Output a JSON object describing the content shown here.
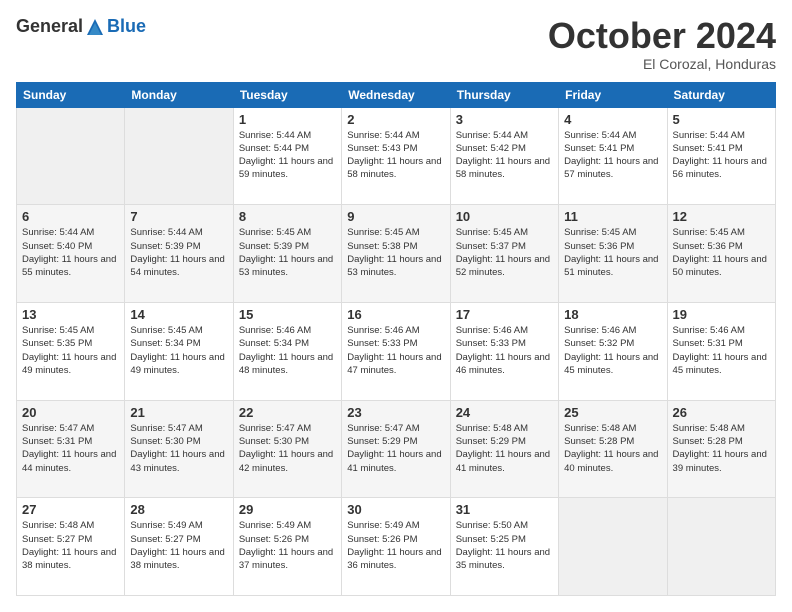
{
  "logo": {
    "general": "General",
    "blue": "Blue"
  },
  "header": {
    "month": "October 2024",
    "location": "El Corozal, Honduras"
  },
  "weekdays": [
    "Sunday",
    "Monday",
    "Tuesday",
    "Wednesday",
    "Thursday",
    "Friday",
    "Saturday"
  ],
  "weeks": [
    [
      null,
      null,
      {
        "day": 1,
        "sunrise": "5:44 AM",
        "sunset": "5:44 PM",
        "daylight": "11 hours and 59 minutes."
      },
      {
        "day": 2,
        "sunrise": "5:44 AM",
        "sunset": "5:43 PM",
        "daylight": "11 hours and 58 minutes."
      },
      {
        "day": 3,
        "sunrise": "5:44 AM",
        "sunset": "5:42 PM",
        "daylight": "11 hours and 58 minutes."
      },
      {
        "day": 4,
        "sunrise": "5:44 AM",
        "sunset": "5:41 PM",
        "daylight": "11 hours and 57 minutes."
      },
      {
        "day": 5,
        "sunrise": "5:44 AM",
        "sunset": "5:41 PM",
        "daylight": "11 hours and 56 minutes."
      }
    ],
    [
      {
        "day": 6,
        "sunrise": "5:44 AM",
        "sunset": "5:40 PM",
        "daylight": "11 hours and 55 minutes."
      },
      {
        "day": 7,
        "sunrise": "5:44 AM",
        "sunset": "5:39 PM",
        "daylight": "11 hours and 54 minutes."
      },
      {
        "day": 8,
        "sunrise": "5:45 AM",
        "sunset": "5:39 PM",
        "daylight": "11 hours and 53 minutes."
      },
      {
        "day": 9,
        "sunrise": "5:45 AM",
        "sunset": "5:38 PM",
        "daylight": "11 hours and 53 minutes."
      },
      {
        "day": 10,
        "sunrise": "5:45 AM",
        "sunset": "5:37 PM",
        "daylight": "11 hours and 52 minutes."
      },
      {
        "day": 11,
        "sunrise": "5:45 AM",
        "sunset": "5:36 PM",
        "daylight": "11 hours and 51 minutes."
      },
      {
        "day": 12,
        "sunrise": "5:45 AM",
        "sunset": "5:36 PM",
        "daylight": "11 hours and 50 minutes."
      }
    ],
    [
      {
        "day": 13,
        "sunrise": "5:45 AM",
        "sunset": "5:35 PM",
        "daylight": "11 hours and 49 minutes."
      },
      {
        "day": 14,
        "sunrise": "5:45 AM",
        "sunset": "5:34 PM",
        "daylight": "11 hours and 49 minutes."
      },
      {
        "day": 15,
        "sunrise": "5:46 AM",
        "sunset": "5:34 PM",
        "daylight": "11 hours and 48 minutes."
      },
      {
        "day": 16,
        "sunrise": "5:46 AM",
        "sunset": "5:33 PM",
        "daylight": "11 hours and 47 minutes."
      },
      {
        "day": 17,
        "sunrise": "5:46 AM",
        "sunset": "5:33 PM",
        "daylight": "11 hours and 46 minutes."
      },
      {
        "day": 18,
        "sunrise": "5:46 AM",
        "sunset": "5:32 PM",
        "daylight": "11 hours and 45 minutes."
      },
      {
        "day": 19,
        "sunrise": "5:46 AM",
        "sunset": "5:31 PM",
        "daylight": "11 hours and 45 minutes."
      }
    ],
    [
      {
        "day": 20,
        "sunrise": "5:47 AM",
        "sunset": "5:31 PM",
        "daylight": "11 hours and 44 minutes."
      },
      {
        "day": 21,
        "sunrise": "5:47 AM",
        "sunset": "5:30 PM",
        "daylight": "11 hours and 43 minutes."
      },
      {
        "day": 22,
        "sunrise": "5:47 AM",
        "sunset": "5:30 PM",
        "daylight": "11 hours and 42 minutes."
      },
      {
        "day": 23,
        "sunrise": "5:47 AM",
        "sunset": "5:29 PM",
        "daylight": "11 hours and 41 minutes."
      },
      {
        "day": 24,
        "sunrise": "5:48 AM",
        "sunset": "5:29 PM",
        "daylight": "11 hours and 41 minutes."
      },
      {
        "day": 25,
        "sunrise": "5:48 AM",
        "sunset": "5:28 PM",
        "daylight": "11 hours and 40 minutes."
      },
      {
        "day": 26,
        "sunrise": "5:48 AM",
        "sunset": "5:28 PM",
        "daylight": "11 hours and 39 minutes."
      }
    ],
    [
      {
        "day": 27,
        "sunrise": "5:48 AM",
        "sunset": "5:27 PM",
        "daylight": "11 hours and 38 minutes."
      },
      {
        "day": 28,
        "sunrise": "5:49 AM",
        "sunset": "5:27 PM",
        "daylight": "11 hours and 38 minutes."
      },
      {
        "day": 29,
        "sunrise": "5:49 AM",
        "sunset": "5:26 PM",
        "daylight": "11 hours and 37 minutes."
      },
      {
        "day": 30,
        "sunrise": "5:49 AM",
        "sunset": "5:26 PM",
        "daylight": "11 hours and 36 minutes."
      },
      {
        "day": 31,
        "sunrise": "5:50 AM",
        "sunset": "5:25 PM",
        "daylight": "11 hours and 35 minutes."
      },
      null,
      null
    ]
  ]
}
